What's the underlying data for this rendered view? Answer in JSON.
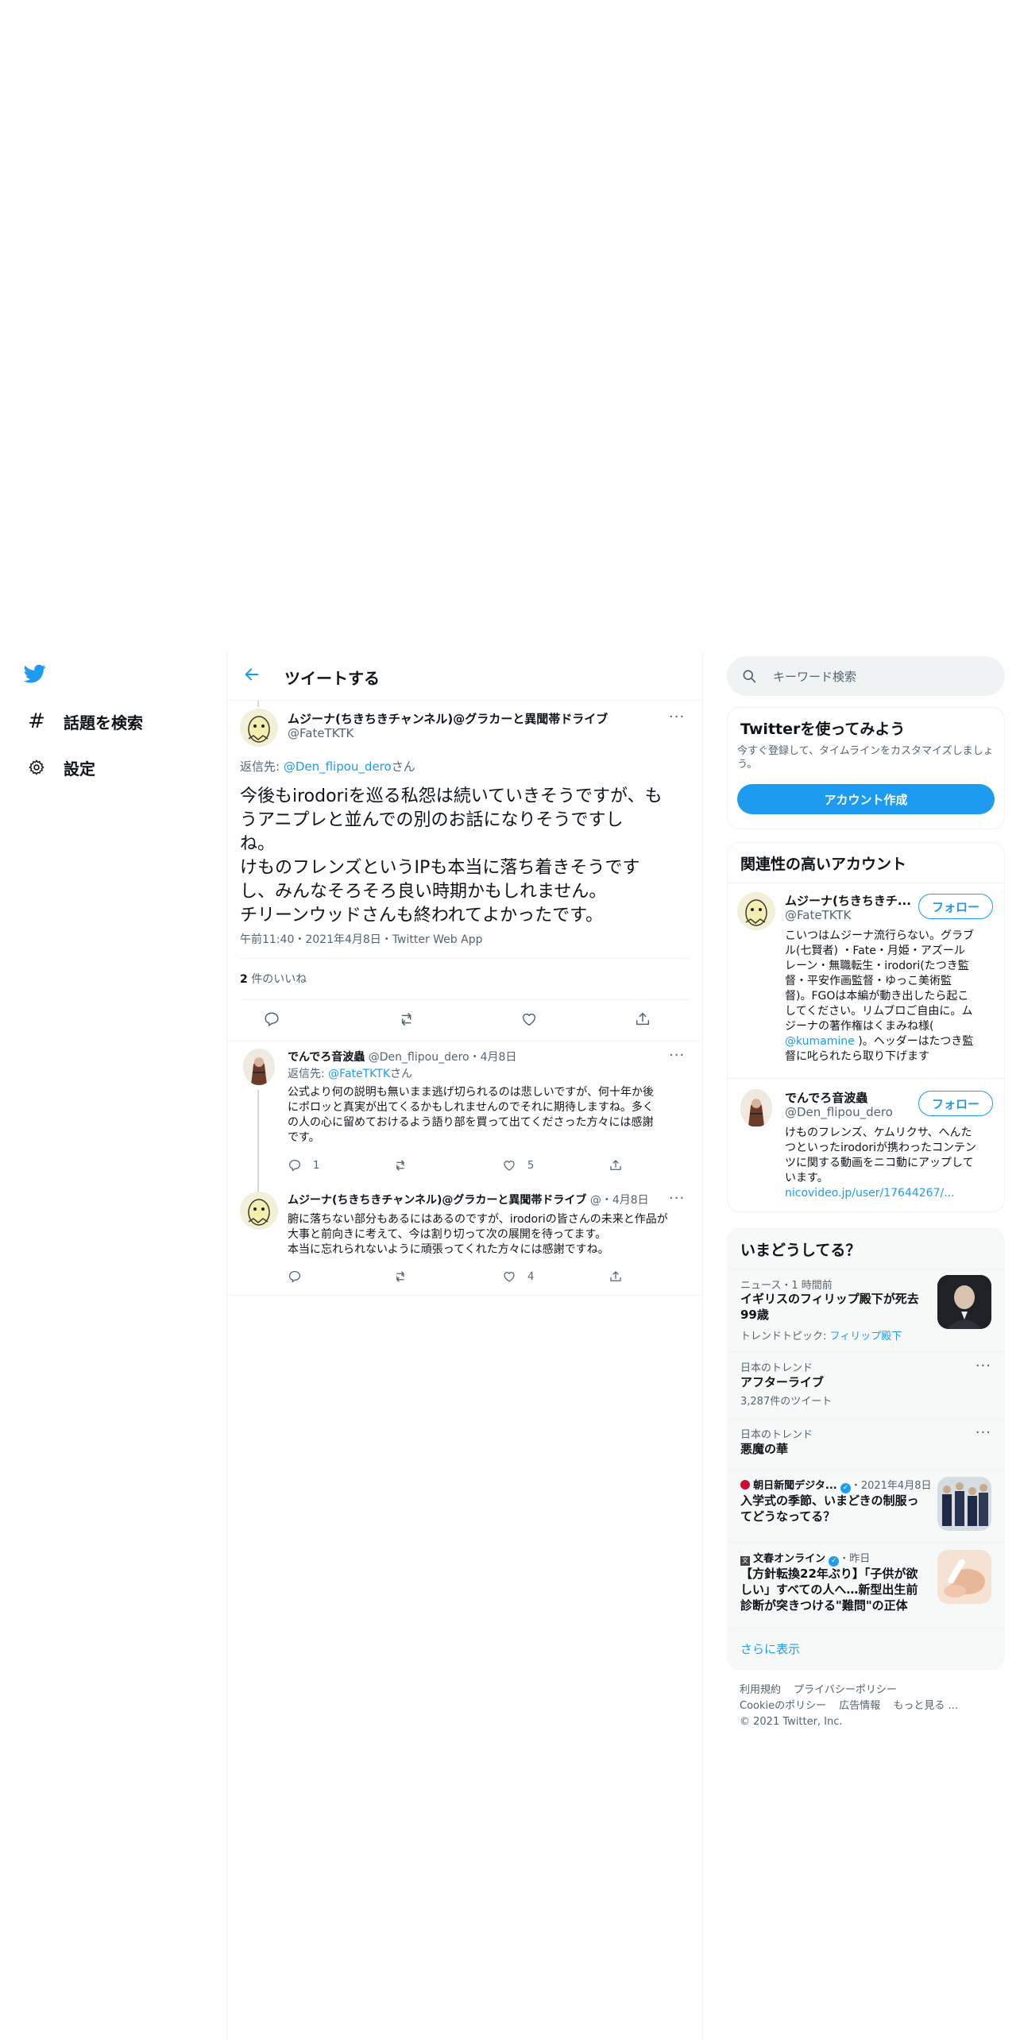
{
  "nav": {
    "items": [
      {
        "label": "話題を検索",
        "icon": "hashtag-icon"
      },
      {
        "label": "設定",
        "icon": "gear-icon"
      }
    ]
  },
  "header": {
    "title": "ツイートする"
  },
  "main_tweet": {
    "name": "ムジーナ(ちきちきチャンネル)@グラカーと異聞帯ドライブ",
    "handle": "@FateTKTK",
    "reply_prefix": "返信先: ",
    "reply_to": "@Den_flipou_dero",
    "reply_suffix": "さん",
    "text_lines": [
      "今後もirodoriを巡る私怨は続いていきそうですが、も",
      "うアニプレと並んでの別のお話になりそうですし",
      "ね。",
      "けものフレンズというIPも本当に落ち着きそうです",
      "し、みんなそろそろ良い時期かもしれません。",
      "チリーンウッドさんも終われてよかったです。"
    ],
    "meta": "午前11:40・2021年4月8日・Twitter Web App",
    "likes_count": "2",
    "likes_label": " 件のいいね"
  },
  "replies": [
    {
      "name": "でんでろ音波蟲",
      "handle": "@Den_flipou_dero",
      "date": "・4月8日",
      "reply_prefix": "返信先: ",
      "reply_to": "@FateTKTK",
      "reply_suffix": "さん",
      "lines": [
        "公式より何の説明も無いまま逃げ切られるのは悲しいですが、何十年か後",
        "にポロッと真実が出てくるかもしれませんのでそれに期待しますね。多く",
        "の人の心に留めておけるよう語り部を買って出てくださった方々には感謝",
        "です。"
      ],
      "reply_count": "1",
      "retweet_count": "",
      "like_count": "5"
    },
    {
      "name": "ムジーナ(ちきちきチャンネル)@グラカーと異聞帯ドライブ",
      "handle": "@",
      "date": "・4月8日",
      "lines": [
        "腑に落ちない部分もあるにはあるのですが、irodoriの皆さんの未来と作品が",
        "大事と前向きに考えて、今は割り切って次の展開を待ってます。",
        "本当に忘れられないように頑張ってくれた方々には感謝ですね。"
      ],
      "reply_count": "",
      "retweet_count": "",
      "like_count": "4"
    }
  ],
  "search": {
    "placeholder": "キーワード検索"
  },
  "signup": {
    "title": "Twitterを使ってみよう",
    "desc_lines": [
      "今すぐ登録して、タイムラインをカスタマイズしましょ",
      "う。"
    ],
    "button": "アカウント作成"
  },
  "related": {
    "title": "関連性の高いアカウント",
    "follow_label": "フォロー",
    "accounts": [
      {
        "name": "ムジーナ(ちきちきチ...",
        "handle": "@FateTKTK",
        "bio_lines": [
          "こいつはムジーナ流行らない。グラブ",
          "ル(七賢者) ・Fate・月姫・アズール",
          "レーン・無職転生・irodori(たつき監",
          "督・平安作画監督・ゆっこ美術監",
          "督)。FGOは本編が動き出したら起こ",
          "してください。リムブロご自由に。ム",
          "ジーナの著作権はくまみね様(",
          "@kumamine",
          " )。ヘッダーはたつき監",
          "督に叱られたら取り下げます"
        ]
      },
      {
        "name": "でんでろ音波蟲",
        "handle": "@Den_flipou_dero",
        "bio_lines": [
          "けものフレンズ、ケムリクサ、へんた",
          "つといったirodoriが携わったコンテン",
          "ツに関する動画をニコ動にアップして",
          "います。",
          "nicovideo.jp/user/17644267/..."
        ]
      }
    ]
  },
  "trends": {
    "title": "いまどうしてる？",
    "items": [
      {
        "category": "ニュース・1 時間前",
        "name_lines": [
          "イギリスのフィリップ殿下が死去",
          "99歳"
        ],
        "sub_prefix": "トレンドトピック: ",
        "sub_link": "フィリップ殿下"
      },
      {
        "category": "日本のトレンド",
        "name_lines": [
          "アフターライブ"
        ],
        "count": "3,287件のツイート"
      },
      {
        "category": "日本のトレンド",
        "name_lines": [
          "悪魔の華"
        ]
      },
      {
        "source": "朝日新聞デジタ...",
        "time": "・2021年4月8日",
        "name_lines": [
          "入学式の季節、いまどきの制服っ",
          "てどうなってる？"
        ]
      },
      {
        "source": "文春オンライン",
        "time": "・昨日",
        "name_lines": [
          "【方針転換22年ぶり】「子供が欲",
          "しい」すべての人へ…新型出生前",
          "診断が突きつける\"難問\"の正体"
        ]
      }
    ],
    "show_more": "さらに表示"
  },
  "footer": {
    "links_row1": [
      "利用規約",
      "プライバシーポリシー"
    ],
    "links_row2": [
      "Cookieのポリシー",
      "広告情報",
      "もっと見る ..."
    ],
    "copyright": "© 2021 Twitter, Inc."
  },
  "colors": {
    "accent": "#1d9bf0",
    "text": "#0f1419",
    "muted": "#536471",
    "border": "#eff3f4"
  }
}
